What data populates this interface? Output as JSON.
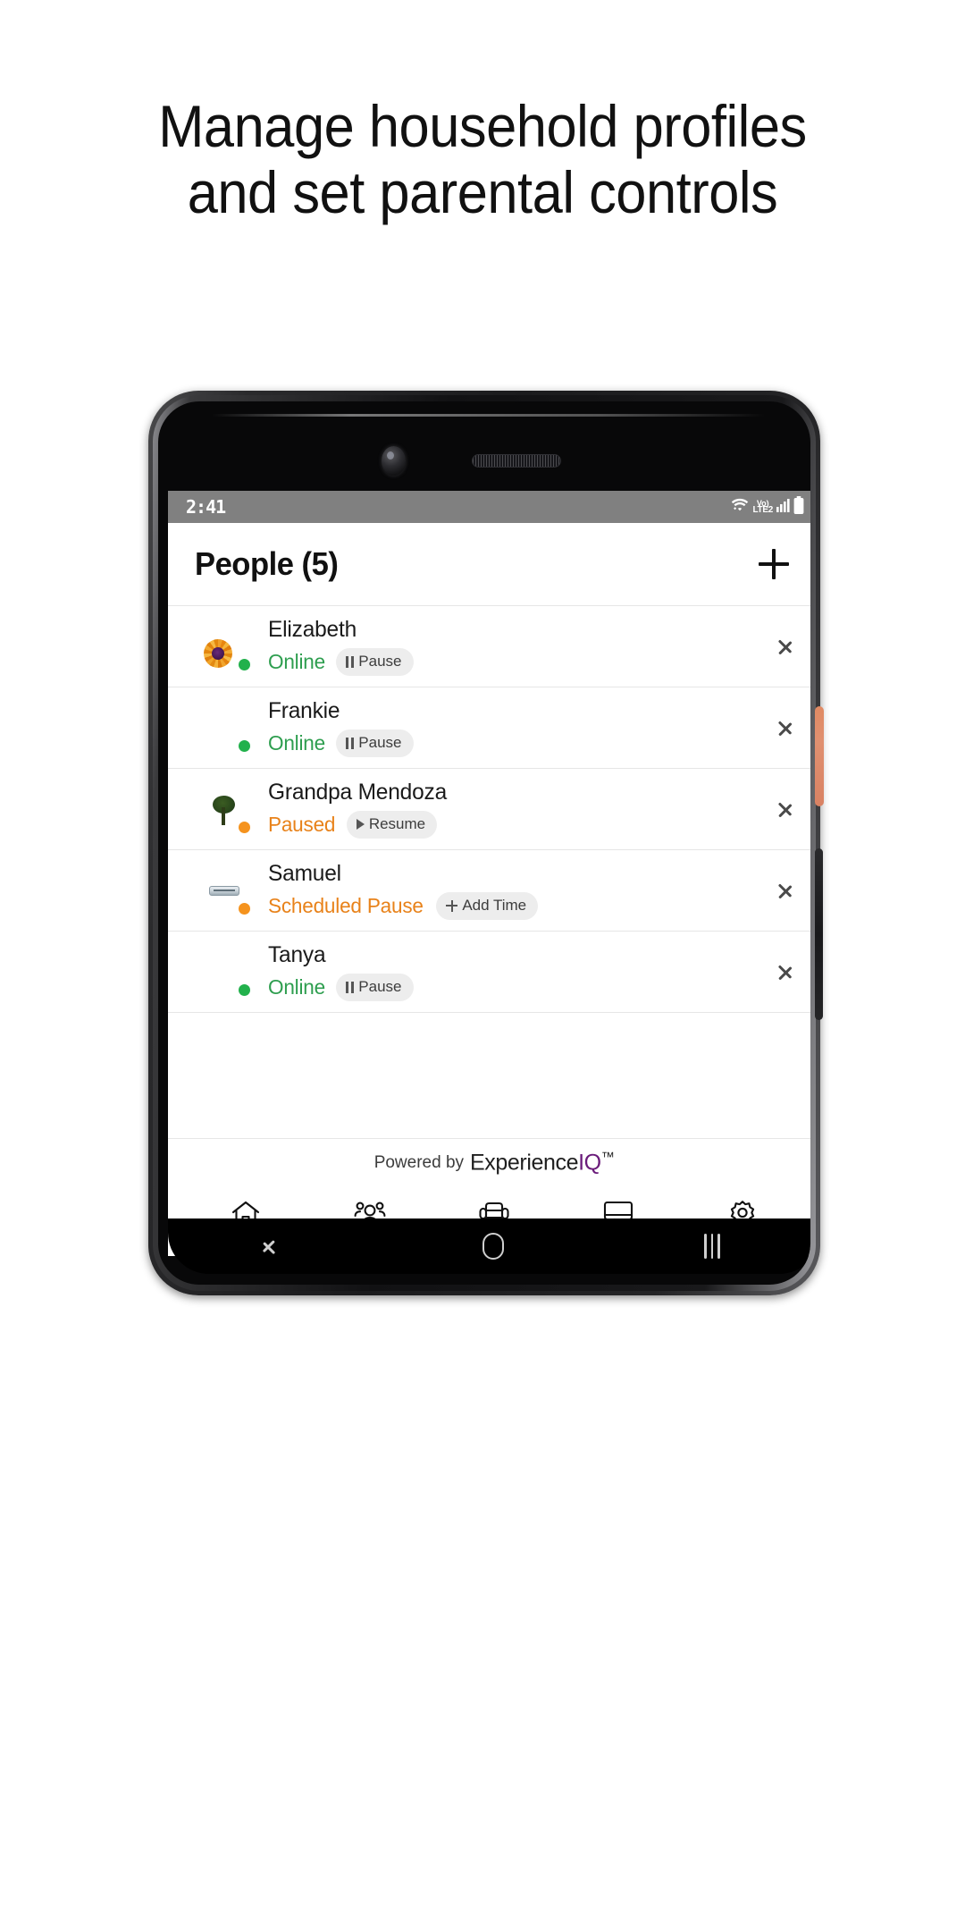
{
  "headline": {
    "line1": "Manage household profiles",
    "line2": "and set parental controls"
  },
  "status_bar": {
    "time": "2:41",
    "wifi_icon": "wifi-icon",
    "volte_top": "Vo)",
    "volte_bottom": "LTE2",
    "signal_icon": "signal-bars-icon",
    "battery_icon": "battery-full-icon"
  },
  "header": {
    "title": "People (5)",
    "add_label": "+"
  },
  "people": [
    {
      "name": "Elizabeth",
      "status": "Online",
      "status_kind": "online",
      "dot": "online",
      "avatar": "photo-flower",
      "chip_label": "Pause",
      "chip_icon": "pause-icon"
    },
    {
      "name": "Frankie",
      "status": "Online",
      "status_kind": "online",
      "dot": "online",
      "avatar": "purple",
      "chip_label": "Pause",
      "chip_icon": "pause-icon"
    },
    {
      "name": "Grandpa Mendoza",
      "status": "Paused",
      "status_kind": "paused",
      "dot": "paused",
      "avatar": "photo-land",
      "chip_label": "Resume",
      "chip_icon": "play-icon"
    },
    {
      "name": "Samuel",
      "status": "Scheduled Pause",
      "status_kind": "paused",
      "dot": "paused",
      "avatar": "photo-device",
      "chip_label": "Add Time",
      "chip_icon": "plus-icon"
    },
    {
      "name": "Tanya",
      "status": "Online",
      "status_kind": "online",
      "dot": "online",
      "avatar": "purple",
      "chip_label": "Pause",
      "chip_icon": "pause-icon"
    }
  ],
  "footer": {
    "powered_by": "Powered by",
    "brand_prefix": "Experience",
    "brand_accent": "IQ",
    "brand_tm": "™"
  },
  "tabs": [
    {
      "name": "home",
      "active": false
    },
    {
      "name": "people",
      "active": true
    },
    {
      "name": "furniture",
      "active": false
    },
    {
      "name": "devices",
      "active": false
    },
    {
      "name": "settings",
      "active": false
    }
  ],
  "android_nav": {
    "back": "back-icon",
    "home": "home-icon",
    "recents": "recents-icon"
  },
  "colors": {
    "online_green": "#2e9e4f",
    "paused_orange": "#e8821a",
    "dot_green": "#22b14c",
    "dot_orange": "#f5931e",
    "brand_purple": "#6a1b7a",
    "avatar_purple": "#78206e",
    "status_bar_gray": "#808080",
    "power_button": "#e08a63"
  }
}
